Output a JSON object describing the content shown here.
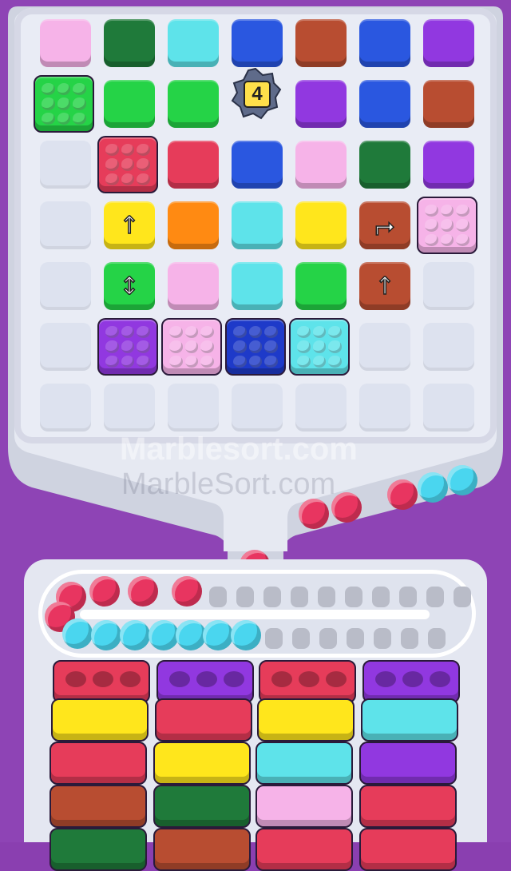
{
  "lock_count": "4",
  "watermarks": {
    "main": "Marblesort.com",
    "sub": "MarbleSort.com"
  },
  "colors": {
    "pink": "#f6b3e8",
    "dark_green": "#1f7a3a",
    "cyan": "#5ee3ea",
    "blue": "#2a57e0",
    "brown": "#b84d31",
    "purple": "#9138e0",
    "green": "#25d347",
    "red": "#e63c5a",
    "orange": "#ff8a12",
    "yellow": "#ffe61c",
    "navy": "#1e3ac9",
    "empty": "#dde2ef"
  },
  "grid": {
    "rows": [
      [
        "pink",
        "dark_green",
        "cyan",
        "blue",
        "brown",
        "blue",
        "purple"
      ],
      [
        "green",
        "green",
        "green",
        "lock",
        "purple",
        "blue",
        "brown"
      ],
      [
        "empty",
        "red",
        "red",
        "blue",
        "pink",
        "dark_green",
        "purple"
      ],
      [
        "empty",
        "yellow",
        "orange",
        "cyan",
        "yellow",
        "brown",
        "pink"
      ],
      [
        "empty",
        "green",
        "pink",
        "cyan",
        "green",
        "brown",
        "empty"
      ],
      [
        "empty",
        "purple",
        "pink",
        "navy",
        "cyan",
        "empty",
        "empty"
      ],
      [
        "empty",
        "empty",
        "empty",
        "empty",
        "empty",
        "empty",
        "empty"
      ]
    ],
    "special_bubble_tiles": [
      "row1-col0 green",
      "row2-col1 red",
      "row3-col6 pink",
      "row5-col1 purple",
      "row5-col2 pink",
      "row5-col3 navy",
      "row5-col4 cyan"
    ],
    "arrow_tiles": [
      "row3-col1 up",
      "row3-col5 turn",
      "row4-col1 updown",
      "row4-col5 up"
    ]
  },
  "track_balls": {
    "red_count": 7,
    "cyan_count": 7
  },
  "stacks": [
    {
      "top": "red",
      "tiles": [
        "yellow",
        "red",
        "brown",
        "dark_green"
      ]
    },
    {
      "top": "purple",
      "tiles": [
        "red",
        "yellow",
        "dark_green",
        "brown"
      ]
    },
    {
      "top": "red",
      "tiles": [
        "yellow",
        "cyan",
        "pink",
        "red"
      ]
    },
    {
      "top": "purple",
      "tiles": [
        "cyan",
        "purple",
        "red",
        "red"
      ]
    }
  ]
}
